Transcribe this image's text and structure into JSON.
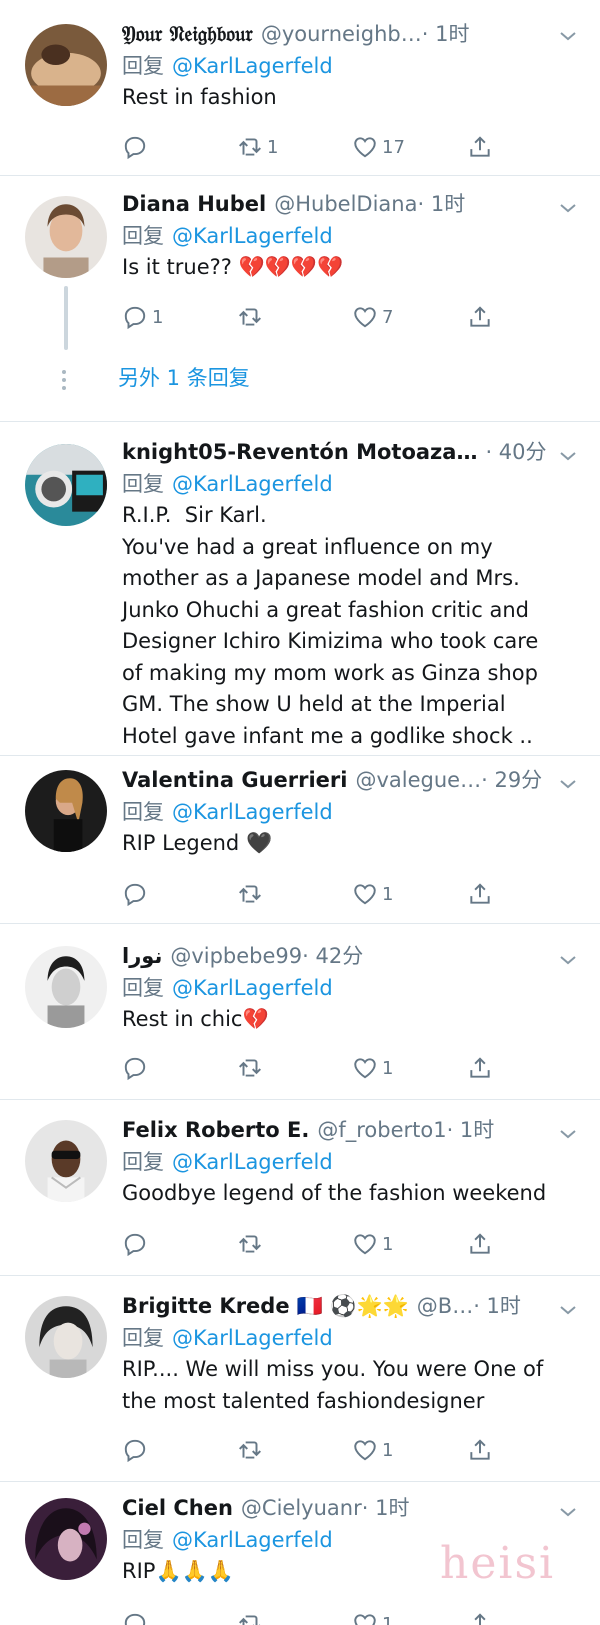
{
  "reply_prefix": "回复",
  "tweets": [
    {
      "name": "𝔜𝔬𝔲𝔯 𝔑𝔢𝔦𝔤𝔥𝔟𝔬𝔲𝔯",
      "handle": "@yourneighb…",
      "time": "· 1时",
      "mention": "@KarlLagerfeld",
      "text": "Rest in fashion",
      "replies": "",
      "retweets": "1",
      "likes": "17"
    },
    {
      "name": "Diana Hubel",
      "handle": "@HubelDiana",
      "time": "· 1时",
      "mention": "@KarlLagerfeld",
      "text": "Is it true?? 💔💔💔💔",
      "replies": "1",
      "retweets": "",
      "likes": "7",
      "more_replies": "另外 1 条回复"
    },
    {
      "name": "knight05-Reventón Motoaza…",
      "handle": "",
      "time": "· 40分",
      "mention": "@KarlLagerfeld",
      "text": "R.I.P.  Sir Karl.\nYou've had a great influence on my mother as a Japanese model and Mrs. Junko Ohuchi a great fashion critic and Designer Ichiro Kimizima who took care of making my mom work as Ginza shop GM. The show U held at the Imperial Hotel gave infant me a godlike shock .."
    },
    {
      "name": "Valentina Guerrieri",
      "handle": "@valegue…",
      "time": "· 29分",
      "mention": "@KarlLagerfeld",
      "text": "RIP Legend 🖤",
      "replies": "",
      "retweets": "",
      "likes": "1"
    },
    {
      "name": "نورا",
      "handle": "@vipbebe99",
      "time": "· 42分",
      "mention": "@KarlLagerfeld",
      "text": "Rest in chic💔",
      "replies": "",
      "retweets": "",
      "likes": "1"
    },
    {
      "name": "Felix Roberto E.",
      "handle": "@f_roberto1",
      "time": "· 1时",
      "mention": "@KarlLagerfeld",
      "text": "Goodbye legend of the fashion weekend",
      "replies": "",
      "retweets": "",
      "likes": "1"
    },
    {
      "name": "Brigitte Krede 🇫🇷 ⚽🌟🌟",
      "handle": "@B…",
      "time": "· 1时",
      "mention": "@KarlLagerfeld",
      "text": "RIP.... We will miss you. You were One of the most talented fashiondesigner",
      "replies": "",
      "retweets": "",
      "likes": "1"
    },
    {
      "name": "Ciel Chen",
      "handle": "@Cielyuanr",
      "time": "· 1时",
      "mention": "@KarlLagerfeld",
      "text": "RIP🙏🙏🙏",
      "replies": "",
      "retweets": "",
      "likes": "1"
    }
  ],
  "watermark": "heisi",
  "icons": [
    "reply-icon",
    "retweet-icon",
    "like-icon",
    "share-icon",
    "chevron-down-icon"
  ],
  "colors": {
    "link": "#1b95e0",
    "secondary": "#657786",
    "text": "#14171a",
    "divider": "#e1e8ed"
  }
}
